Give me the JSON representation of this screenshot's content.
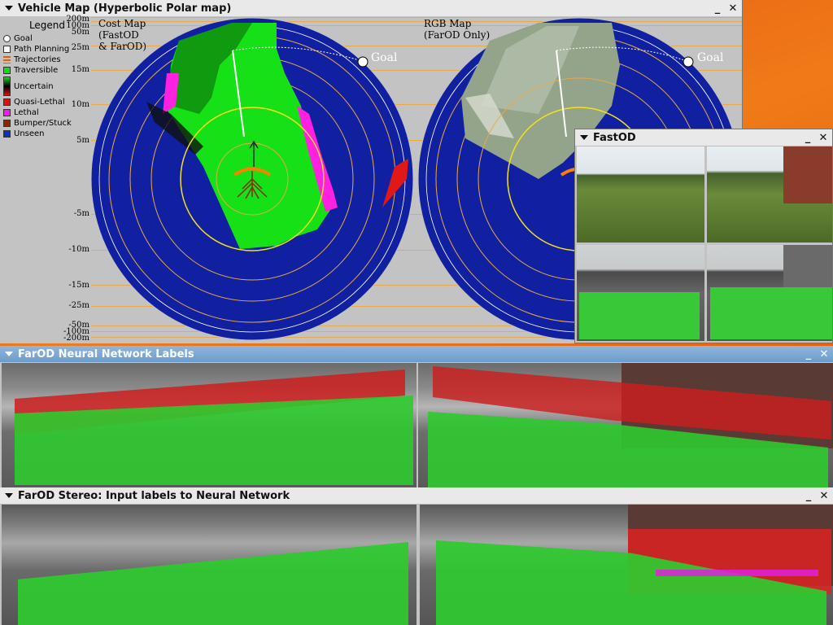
{
  "vehicle_map": {
    "title": "Vehicle Map (Hyperbolic Polar map)",
    "legend": {
      "header": "Legend",
      "items": [
        {
          "label": "Goal",
          "color": "#ffffff",
          "icon": "goal-circle-icon"
        },
        {
          "label": "Path Planning",
          "color": "#ffffff"
        },
        {
          "label": "Trajectories",
          "color": "#e06010"
        },
        {
          "label": "Traversible",
          "color": "#10e010"
        },
        {
          "label": "Uncertain",
          "color": "#000000"
        },
        {
          "label": "Quasi-Lethal",
          "color": "#e01010"
        },
        {
          "label": "Lethal",
          "color": "#ff10ff"
        },
        {
          "label": "Bumper/Stuck",
          "color": "#8a2a00"
        },
        {
          "label": "Unseen",
          "color": "#1030c0"
        }
      ]
    },
    "range_labels": [
      "200m",
      "100m",
      "50m",
      "25m",
      "15m",
      "10m",
      "5m",
      "-5m",
      "-10m",
      "-15m",
      "-25m",
      "-50m",
      "-100m",
      "-200m"
    ],
    "cost_map_label": "Cost Map\n(FastOD\n& FarOD)",
    "rgb_map_label": "RGB Map\n(FarOD Only)",
    "goal_label": "Goal"
  },
  "fastod": {
    "title": "FastOD"
  },
  "farod_nn": {
    "title": "FarOD Neural Network Labels"
  },
  "farod_stereo": {
    "title": "FarOD Stereo: Input labels to Neural Network"
  },
  "window_controls": {
    "minimize": "_",
    "close": "✕"
  },
  "colors": {
    "unseen": "#1020a0",
    "traversible": "#16e016",
    "lethal": "#ff20e0",
    "rings": "#e8a94a",
    "ring_yellow": "#f4e020"
  }
}
